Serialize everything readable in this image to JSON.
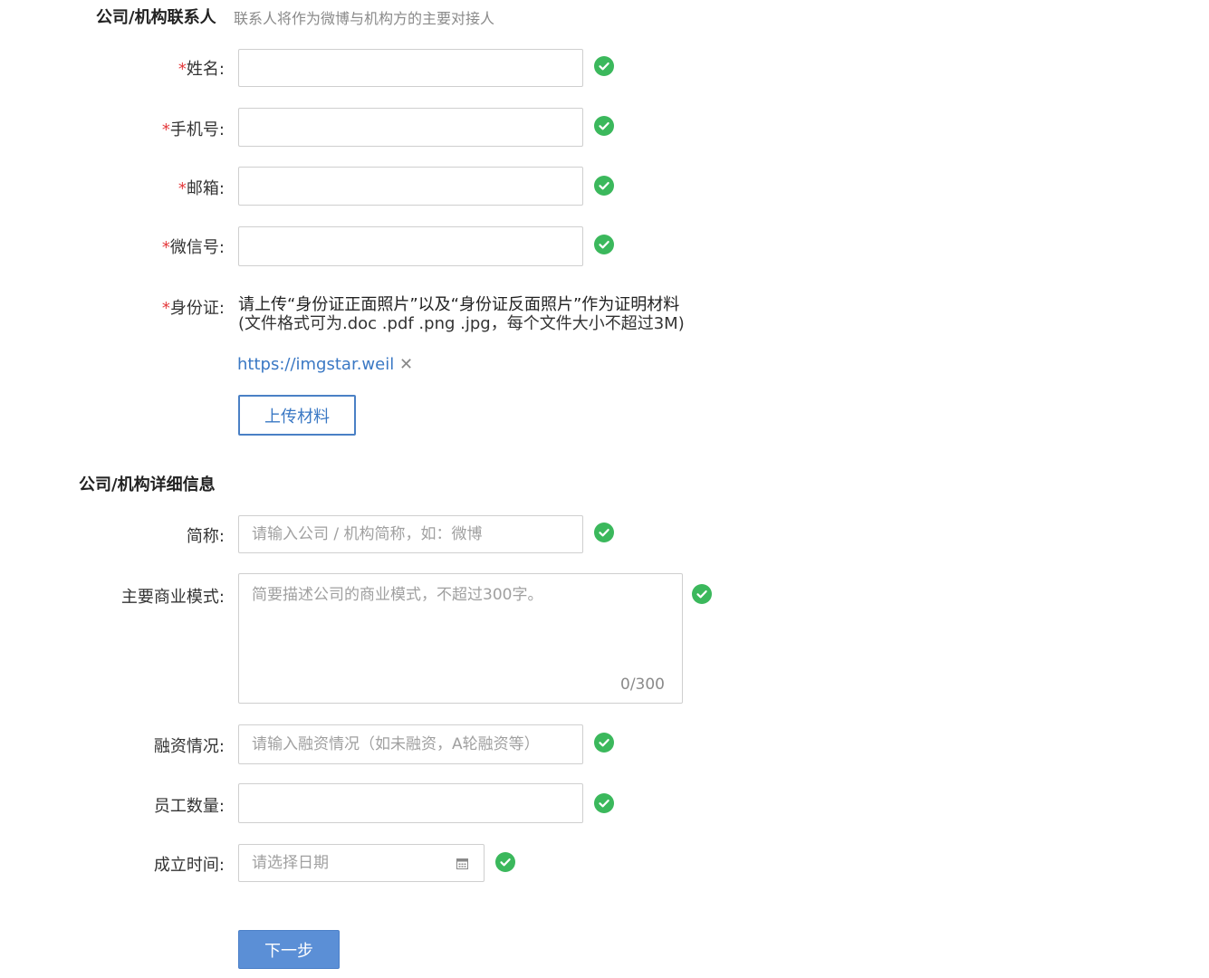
{
  "contact_section": {
    "title": "公司/机构联系人",
    "subtitle": "联系人将作为微博与机构方的主要对接人"
  },
  "fields": {
    "name": {
      "required_mark": "*",
      "label": "姓名:",
      "value": ""
    },
    "phone": {
      "required_mark": "*",
      "label": "手机号:",
      "value": ""
    },
    "email": {
      "required_mark": "*",
      "label": "邮箱:",
      "value": ""
    },
    "wechat": {
      "required_mark": "*",
      "label": "微信号:",
      "value": ""
    },
    "id_card": {
      "required_mark": "*",
      "label": "身份证:",
      "instruction": "请上传“身份证正面照片”以及“身份证反面照片”作为证明材料",
      "format_note": "(文件格式可为.doc .pdf .png .jpg，每个文件大小不超过3M)",
      "uploaded_file": "https://imgstar.weil",
      "remove_icon": "close-icon",
      "upload_button": "上传材料"
    }
  },
  "detail_section": {
    "title": "公司/机构详细信息"
  },
  "detail_fields": {
    "short_name": {
      "label": "简称:",
      "placeholder": "请输入公司 / 机构简称，如：微博"
    },
    "business_model": {
      "label": "主要商业模式:",
      "placeholder": "简要描述公司的商业模式，不超过300字。",
      "counter": "0/300"
    },
    "financing": {
      "label": "融资情况:",
      "placeholder": "请输入融资情况（如未融资，A轮融资等）"
    },
    "employees": {
      "label": "员工数量:",
      "value": ""
    },
    "founded": {
      "label": "成立时间:",
      "placeholder": "请选择日期",
      "icon": "calendar-icon"
    }
  },
  "next_button": "下一步",
  "colors": {
    "required": "#e4393c",
    "check_green": "#3bb85c",
    "link_blue": "#3a78c4",
    "primary_button": "#5b8fd6"
  }
}
